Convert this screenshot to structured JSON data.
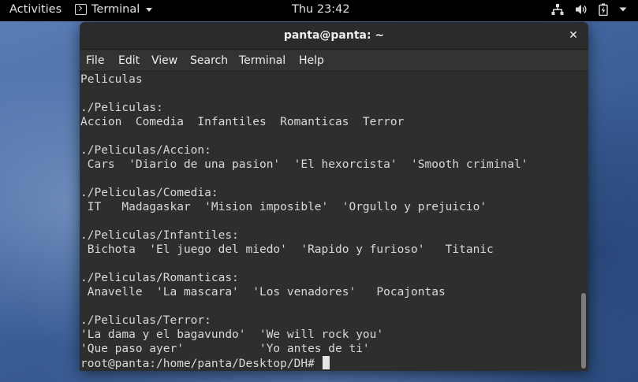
{
  "topbar": {
    "activities": "Activities",
    "app_name": "Terminal",
    "clock": "Thu 23:42"
  },
  "window": {
    "title": "panta@panta: ~",
    "menu": [
      "File",
      "Edit",
      "View",
      "Search",
      "Terminal",
      "Help"
    ]
  },
  "terminal": {
    "lines": [
      "Peliculas",
      "",
      "./Peliculas:",
      "Accion  Comedia  Infantiles  Romanticas  Terror",
      "",
      "./Peliculas/Accion:",
      " Cars  'Diario de una pasion'  'El hexorcista'  'Smooth criminal'",
      "",
      "./Peliculas/Comedia:",
      " IT   Madagaskar  'Mision imposible'  'Orgullo y prejuicio'",
      "",
      "./Peliculas/Infantiles:",
      " Bichota  'El juego del miedo'  'Rapido y furioso'   Titanic",
      "",
      "./Peliculas/Romanticas:",
      " Anavelle  'La mascara'  'Los venadores'   Pocajontas",
      "",
      "./Peliculas/Terror:",
      "'La dama y el bagavundo'  'We will rock you'",
      "'Que paso ayer'           'Yo antes de ti'"
    ],
    "prompt": "root@panta:/home/panta/Desktop/DH# ",
    "input": ""
  },
  "icons": {
    "network": "network-wired-icon",
    "volume": "volume-icon",
    "battery": "battery-charging-icon",
    "power_menu": "chevron-down-icon"
  }
}
